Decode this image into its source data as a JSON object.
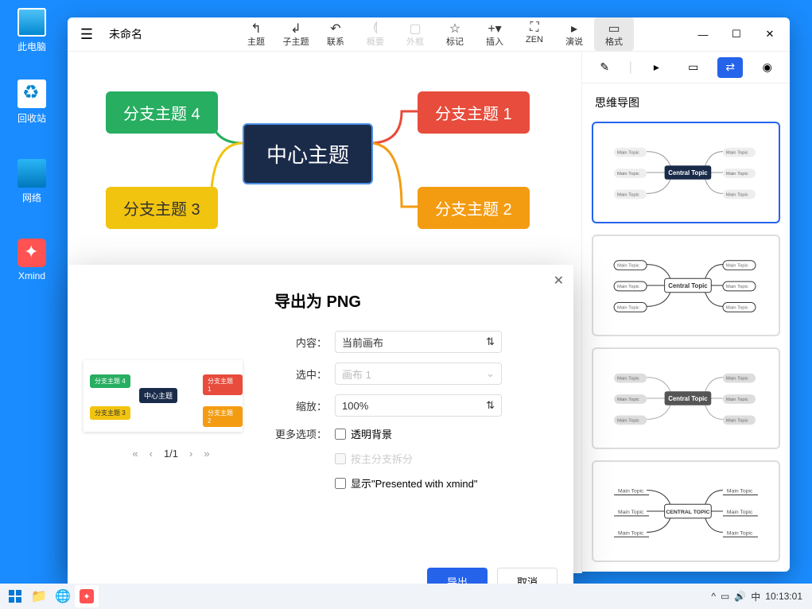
{
  "desktop": {
    "this_pc": "此电脑",
    "recycle": "回收站",
    "network": "网络",
    "xmind": "Xmind"
  },
  "window": {
    "title": "未命名",
    "toolbar": [
      {
        "label": "主题",
        "icon": "↰"
      },
      {
        "label": "子主题",
        "icon": "↲"
      },
      {
        "label": "联系",
        "icon": "↶"
      },
      {
        "label": "概要",
        "icon": "⟬",
        "disabled": true
      },
      {
        "label": "外框",
        "icon": "▢",
        "disabled": true
      },
      {
        "label": "标记",
        "icon": "☆"
      },
      {
        "label": "插入",
        "icon": "+▾"
      },
      {
        "label": "ZEN",
        "icon": "⛶"
      },
      {
        "label": "演说",
        "icon": "▸"
      },
      {
        "label": "格式",
        "icon": "▭",
        "active": true
      }
    ]
  },
  "mindmap": {
    "center": "中心主题",
    "b1": "分支主题 1",
    "b2": "分支主题 2",
    "b3": "分支主题 3",
    "b4": "分支主题 4"
  },
  "panel": {
    "title": "思维导图",
    "tpl_center": "Central Topic",
    "tpl_main": "Main Topic",
    "tpl_center_caps": "CENTRAL TOPIC"
  },
  "dialog": {
    "title": "导出为 PNG",
    "content_label": "内容：",
    "content_value": "当前画布",
    "selected_label": "选中：",
    "selected_value": "画布 1",
    "zoom_label": "缩放：",
    "zoom_value": "100%",
    "more_label": "更多选项：",
    "transparent": "透明背景",
    "split": "按主分支拆分",
    "presented": "显示\"Presented with xmind\"",
    "export": "导出",
    "cancel": "取消",
    "pager": "1/1",
    "pv_center": "中心主题",
    "pv1": "分支主题 1",
    "pv2": "分支主题 2",
    "pv3": "分支主题 3",
    "pv4": "分支主题 4"
  },
  "taskbar": {
    "ime": "中",
    "time": "10:13:01"
  }
}
